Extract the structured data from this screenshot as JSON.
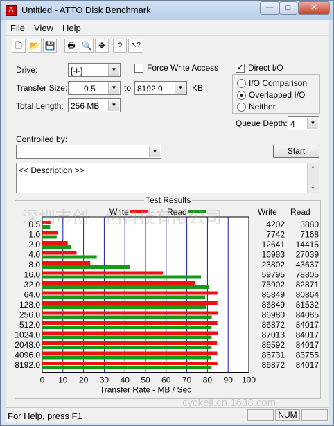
{
  "window": {
    "title": "Untitled - ATTO Disk Benchmark",
    "app_icon_text": "A"
  },
  "menu": [
    "File",
    "View",
    "Help"
  ],
  "toolbar": [
    {
      "icon": "new-file-icon",
      "glyph": "🗋"
    },
    {
      "icon": "open-folder-icon",
      "glyph": "📂"
    },
    {
      "icon": "save-icon",
      "glyph": "💾"
    },
    {
      "icon": "print-icon",
      "glyph": "🖶"
    },
    {
      "icon": "print-preview-icon",
      "glyph": "🔍"
    },
    {
      "icon": "move-icon",
      "glyph": "✥"
    },
    {
      "icon": "help-icon",
      "glyph": "?"
    },
    {
      "icon": "context-help-icon",
      "glyph": "↖?"
    }
  ],
  "settings": {
    "drive_label": "Drive:",
    "drive_value": "[-i-]",
    "force_write_label": "Force Write Access",
    "force_write_checked": false,
    "direct_io_label": "Direct I/O",
    "direct_io_checked": true,
    "transfer_label": "Transfer Size:",
    "transfer_from": "0.5",
    "to_label": "to",
    "transfer_to": "8192.0",
    "kb_label": "KB",
    "total_length_label": "Total Length:",
    "total_length_value": "256 MB",
    "io_comparison_label": "I/O Comparison",
    "overlapped_io_label": "Overlapped I/O",
    "neither_label": "Neither",
    "selected_mode": "overlapped",
    "queue_depth_label": "Queue Depth:",
    "queue_depth_value": "4",
    "controlled_by_label": "Controlled by:",
    "controlled_by_value": "",
    "start_button": "Start",
    "description": "<< Description >>"
  },
  "results": {
    "title": "Test Results",
    "legend_write": "Write",
    "legend_read": "Read",
    "col_write": "Write",
    "col_read": "Read"
  },
  "chart_data": {
    "type": "bar",
    "orientation": "horizontal",
    "title": "Test Results",
    "xlabel": "Transfer Rate - MB / Sec",
    "xlim": [
      0,
      100
    ],
    "xticks": [
      0,
      10,
      20,
      30,
      40,
      50,
      60,
      70,
      80,
      90,
      100
    ],
    "categories": [
      "0.5",
      "1.0",
      "2.0",
      "4.0",
      "8.0",
      "16.0",
      "32.0",
      "64.0",
      "128.0",
      "256.0",
      "512.0",
      "1024.0",
      "2048.0",
      "4096.0",
      "8192.0"
    ],
    "series": [
      {
        "name": "Write",
        "color": "#ee1111",
        "values": [
          4.1,
          7.6,
          12.3,
          16.6,
          23.2,
          58.4,
          74.1,
          84.8,
          84.8,
          84.9,
          84.8,
          85.0,
          84.6,
          84.7,
          84.8
        ]
      },
      {
        "name": "Read",
        "color": "#159a15",
        "values": [
          3.8,
          7.0,
          14.1,
          26.4,
          42.6,
          76.9,
          80.9,
          78.9,
          79.6,
          82.1,
          82.0,
          82.0,
          82.0,
          81.8,
          82.0
        ]
      }
    ],
    "table": {
      "write": [
        "4202",
        "7742",
        "12641",
        "16983",
        "23802",
        "59795",
        "75902",
        "86849",
        "86849",
        "86980",
        "86872",
        "87013",
        "86592",
        "86731",
        "86872"
      ],
      "read": [
        "3880",
        "7168",
        "14415",
        "27039",
        "43637",
        "78805",
        "82871",
        "80864",
        "81532",
        "84085",
        "84017",
        "84017",
        "84017",
        "83755",
        "84017"
      ]
    }
  },
  "status": {
    "text": "For Help, press F1",
    "num": "NUM"
  },
  "watermark": {
    "text": "深圳市创一创科技有限公司",
    "text2": "cyckeji.cn.1688.com"
  }
}
